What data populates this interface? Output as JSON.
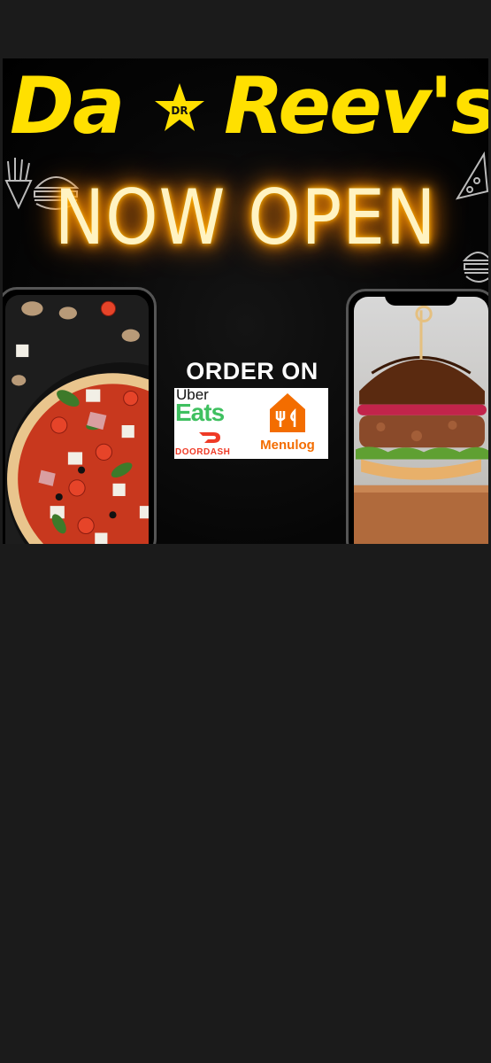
{
  "banner": {
    "brand_left": "Da",
    "brand_right": "Reev's",
    "logo_monogram": "DR",
    "headline": "NOW OPEN",
    "order_on": "ORDER ON",
    "delivery": {
      "uber_top": "Uber",
      "uber_bottom": "Eats",
      "doordash": "DOORDASH",
      "menulog": "Menulog"
    }
  },
  "colors": {
    "brand_yellow": "#ffe000",
    "neon_glow": "#ff9800",
    "uber_green": "#3fc060",
    "doordash_red": "#ef3a26",
    "menulog_orange": "#f36d00",
    "page_background": "#1b1b1b"
  },
  "icons": [
    "star-logo-icon",
    "burger-icon",
    "fries-icon",
    "pizza-slice-icon",
    "doordash-icon",
    "menulog-house-icon"
  ]
}
